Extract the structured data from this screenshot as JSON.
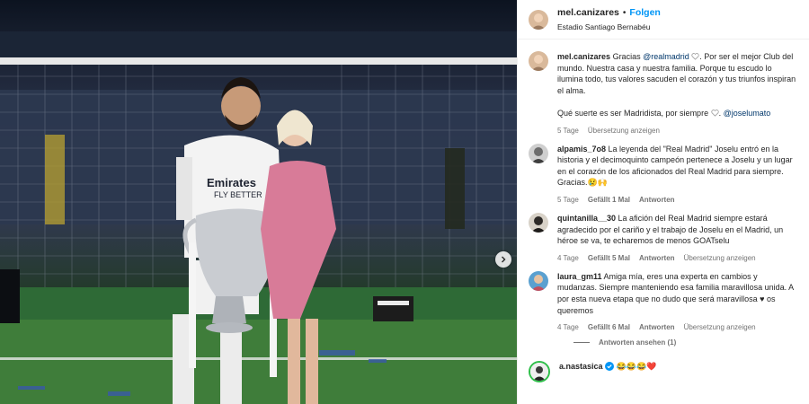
{
  "photo": {
    "alt_subject": "player-with-trophy",
    "next_icon": "chevron-right-icon",
    "jersey_text": [
      "Emirates",
      "FLY BETTER"
    ]
  },
  "header": {
    "username": "mel.canizares",
    "separator": "•",
    "follow": "Folgen",
    "location": "Estadio Santiago Bernabéu"
  },
  "caption": {
    "username": "mel.canizares",
    "text_1": "Gracias",
    "mention_1": "@realmadrid",
    "text_2": ". Por ser el mejor Club del mundo. Nuestra casa y nuestra familia. Porque tu escudo lo ilumina todo, tus valores sacuden el corazón y tus triunfos inspiran el alma.",
    "text_3": "Qué suerte es ser Madridista, por siempre",
    "text_4": ".",
    "mention_2": "@joselumato",
    "time": "5 Tage",
    "translate": "Übersetzung anzeigen"
  },
  "comments": [
    {
      "username": "alpamis_7o8",
      "text": "La leyenda del \"Real Madrid\" Joselu entró en la historia y el decimoquinto campeón pertenece a Joselu y un lugar en el corazón de los aficionados del Real Madrid para siempre. Gracias.😢🙌",
      "time": "5 Tage",
      "likes": "Gefällt 1 Mal",
      "reply": "Antworten"
    },
    {
      "username": "quintanilla__30",
      "text": "La afición del Real Madrid siempre estará agradecido por el cariño y el trabajo de Joselu en el Madrid, un héroe se va, te echaremos de menos GOATselu",
      "time": "4 Tage",
      "likes": "Gefällt 5 Mal",
      "reply": "Antworten",
      "translate": "Übersetzung anzeigen"
    },
    {
      "username": "laura_gm11",
      "text": "Amiga mía, eres una experta en cambios y mudanzas. Siempre manteniendo esa familia maravillosa unida. A por esta nueva etapa que no dudo que será maravillosa ♥ os queremos",
      "time": "4 Tage",
      "likes": "Gefällt 6 Mal",
      "reply": "Antworten",
      "translate": "Übersetzung anzeigen"
    }
  ],
  "replies_toggle": "Antworten ansehen (1)",
  "last_comment": {
    "username": "a.nastasica",
    "emojis": "😂😂😂❤️"
  },
  "colors": {
    "link_blue": "#0095f6",
    "mention_blue": "#00376b",
    "muted": "#737373",
    "verified": "#0095f6"
  }
}
